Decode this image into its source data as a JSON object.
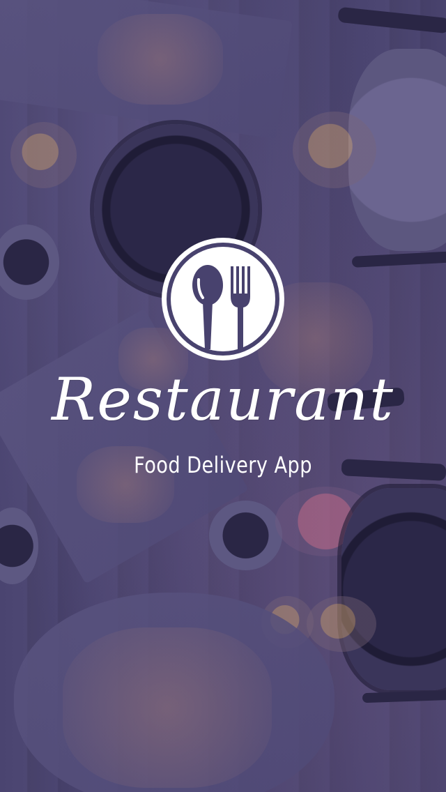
{
  "splash": {
    "app_name": "Restaurant",
    "tagline": "Food Delivery App",
    "logo_icon": "spoon-fork-icon",
    "background": "restaurant-table-photo"
  },
  "colors": {
    "overlay": "#48426e",
    "text": "#ffffff",
    "logo": "#ffffff"
  }
}
